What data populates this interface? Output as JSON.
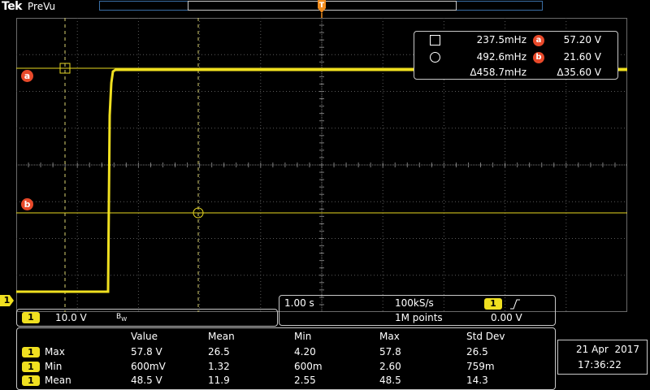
{
  "header": {
    "brand": "Tek",
    "mode": "PreVu"
  },
  "refs": {
    "a": "a",
    "b": "b"
  },
  "cursors": {
    "c1_freq": "237.5mHz",
    "c1_ref": "a",
    "c1_volt": "57.20 V",
    "c2_freq": "492.6mHz",
    "c2_ref": "b",
    "c2_volt": "21.60 V",
    "delta_freq": "Δ458.7mHz",
    "delta_volt": "Δ35.60 V"
  },
  "channel": {
    "marker": "1",
    "num": "1",
    "scale": "10.0 V",
    "bw": "B",
    "bw_sub": "W",
    "color": "#f0e020"
  },
  "horizontal": {
    "timebase": "1.00 s",
    "sample_rate": "100kS/s",
    "record": "1M points",
    "trig_source": "1",
    "trig_level": "0.00 V"
  },
  "measurements": {
    "headers": [
      "Value",
      "Mean",
      "Min",
      "Max",
      "Std Dev"
    ],
    "rows": [
      {
        "ch": "1",
        "name": "Max",
        "value": "57.8 V",
        "mean": "26.5",
        "min": "4.20",
        "max": "57.8",
        "std": "26.5"
      },
      {
        "ch": "1",
        "name": "Min",
        "value": "600mV",
        "mean": "1.32",
        "min": "600m",
        "max": "2.60",
        "std": "759m"
      },
      {
        "ch": "1",
        "name": "Mean",
        "value": "48.5 V",
        "mean": "11.9",
        "min": "2.55",
        "max": "48.5",
        "std": "14.3"
      }
    ]
  },
  "datetime": {
    "date": "21 Apr  2017",
    "time": "17:36:22"
  },
  "colors": {
    "trace": "#f0e020",
    "ref_badge": "#e8492a",
    "record_bar": "#3a6ea5",
    "trigger": "#f08c1e"
  }
}
